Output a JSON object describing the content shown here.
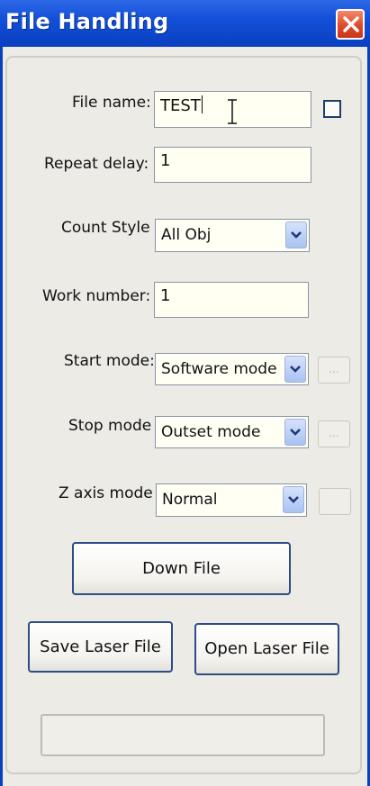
{
  "window": {
    "title": "File Handling",
    "close_label": "Close"
  },
  "form": {
    "file_name": {
      "label": "File name:",
      "value": "TEST",
      "checkbox_checked": false
    },
    "repeat_delay": {
      "label": "Repeat delay:",
      "value": "1"
    },
    "count_style": {
      "label": "Count Style",
      "value": "All Obj"
    },
    "work_number": {
      "label": "Work number:",
      "value": "1"
    },
    "start_mode": {
      "label": "Start mode:",
      "value": "Software mode",
      "extra_button": "..."
    },
    "stop_mode": {
      "label": "Stop mode",
      "value": "Outset mode",
      "extra_button": "..."
    },
    "z_axis_mode": {
      "label": "Z axis mode",
      "value": "Normal",
      "extra_button": ""
    }
  },
  "buttons": {
    "down_file": "Down File",
    "save_laser_file": "Save Laser File",
    "open_laser_file": "Open Laser File"
  },
  "status_text": "",
  "colors": {
    "title_bar": "#1250d8",
    "close_button": "#de4a2a",
    "window_bg": "#ecebe5",
    "field_bg": "#fffff2",
    "button_border": "#2c4d86"
  },
  "icons": [
    "close-icon",
    "chevron-down-icon",
    "text-cursor-icon"
  ]
}
